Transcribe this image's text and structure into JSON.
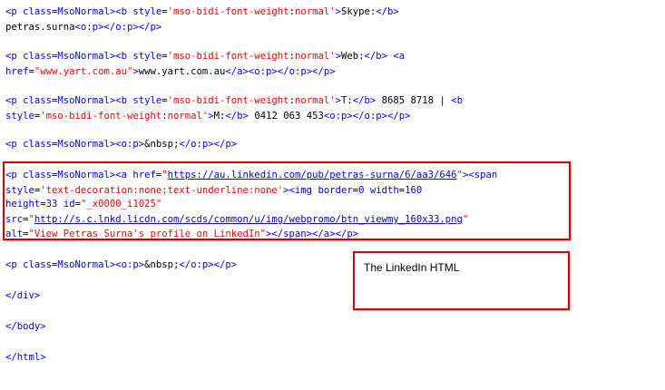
{
  "lines": [
    {
      "segs": [
        [
          "b",
          "<p "
        ],
        [
          "b",
          "class"
        ],
        [
          "t",
          "="
        ],
        [
          "b",
          "MsoNormal"
        ],
        [
          "b",
          "><b "
        ],
        [
          "b",
          "style"
        ],
        [
          "t",
          "="
        ],
        [
          "a",
          "'mso-bidi-font-weight"
        ],
        [
          "t",
          ":"
        ],
        [
          "a",
          "normal'"
        ],
        [
          "b",
          ">"
        ],
        [
          "t",
          "Skype:"
        ],
        [
          "b",
          "</b>"
        ]
      ]
    },
    {
      "segs": [
        [
          "t",
          "petras.surna"
        ],
        [
          "b",
          "<o:p></o:p></p>"
        ]
      ]
    },
    {
      "segs": []
    },
    {
      "segs": [
        [
          "b",
          "<p "
        ],
        [
          "b",
          "class"
        ],
        [
          "t",
          "="
        ],
        [
          "b",
          "MsoNormal"
        ],
        [
          "b",
          "><b "
        ],
        [
          "b",
          "style"
        ],
        [
          "t",
          "="
        ],
        [
          "a",
          "'mso-bidi-font-weight"
        ],
        [
          "t",
          ":"
        ],
        [
          "a",
          "normal'"
        ],
        [
          "b",
          ">"
        ],
        [
          "t",
          "Web:"
        ],
        [
          "b",
          "</b> <a"
        ]
      ]
    },
    {
      "segs": [
        [
          "b",
          "href"
        ],
        [
          "t",
          "="
        ],
        [
          "a",
          "\"www.yart.com.au\""
        ],
        [
          "b",
          ">"
        ],
        [
          "t",
          "www.yart.com.au"
        ],
        [
          "b",
          "</a><o:p></o:p></p>"
        ]
      ]
    },
    {
      "segs": []
    },
    {
      "segs": [
        [
          "b",
          "<p "
        ],
        [
          "b",
          "class"
        ],
        [
          "t",
          "="
        ],
        [
          "b",
          "MsoNormal"
        ],
        [
          "b",
          "><b "
        ],
        [
          "b",
          "style"
        ],
        [
          "t",
          "="
        ],
        [
          "a",
          "'mso-bidi-font-weight"
        ],
        [
          "t",
          ":"
        ],
        [
          "a",
          "normal'"
        ],
        [
          "b",
          ">"
        ],
        [
          "t",
          "T:"
        ],
        [
          "b",
          "</b>"
        ],
        [
          "t",
          " 8685 8718 | "
        ],
        [
          "b",
          "<b"
        ]
      ]
    },
    {
      "segs": [
        [
          "b",
          "style"
        ],
        [
          "t",
          "="
        ],
        [
          "a",
          "'mso-bidi-font-weight"
        ],
        [
          "t",
          ":"
        ],
        [
          "a",
          "normal'"
        ],
        [
          "b",
          ">"
        ],
        [
          "t",
          "M:"
        ],
        [
          "b",
          "</b>"
        ],
        [
          "t",
          " 0412 063 453"
        ],
        [
          "b",
          "<o:p></o:p></p>"
        ]
      ]
    },
    {
      "segs": []
    },
    {
      "segs": [
        [
          "b",
          "<p "
        ],
        [
          "b",
          "class"
        ],
        [
          "t",
          "="
        ],
        [
          "b",
          "MsoNormal"
        ],
        [
          "b",
          "><o:p>"
        ],
        [
          "t",
          "&nbsp;"
        ],
        [
          "b",
          "</o:p></p>"
        ]
      ]
    },
    {
      "segs": []
    },
    {
      "segs": [
        [
          "b",
          "<p "
        ],
        [
          "b",
          "class"
        ],
        [
          "t",
          "="
        ],
        [
          "b",
          "MsoNormal"
        ],
        [
          "b",
          "><a "
        ],
        [
          "b",
          "href"
        ],
        [
          "t",
          "="
        ],
        [
          "a",
          "\""
        ],
        [
          "link",
          "https://au.linkedin.com/pub/petras-surna/6/aa3/646"
        ],
        [
          "a",
          "\""
        ],
        [
          "b",
          "><span"
        ]
      ]
    },
    {
      "segs": [
        [
          "b",
          "style"
        ],
        [
          "t",
          "="
        ],
        [
          "a",
          "'text-decoration:none;text-underline:none'"
        ],
        [
          "b",
          "><img "
        ],
        [
          "b",
          "border"
        ],
        [
          "t",
          "="
        ],
        [
          "b",
          "0 "
        ],
        [
          "b",
          "width"
        ],
        [
          "t",
          "="
        ],
        [
          "b",
          "160"
        ]
      ]
    },
    {
      "segs": [
        [
          "b",
          "height"
        ],
        [
          "t",
          "="
        ],
        [
          "b",
          "33 "
        ],
        [
          "b",
          "id"
        ],
        [
          "t",
          "="
        ],
        [
          "a",
          "\"_x0000_i1025\""
        ]
      ]
    },
    {
      "segs": [
        [
          "b",
          "src"
        ],
        [
          "t",
          "="
        ],
        [
          "a",
          "\""
        ],
        [
          "link",
          "http://s.c.lnkd.licdn.com/scds/common/u/img/webpromo/btn_viewmy_160x33.png"
        ],
        [
          "a",
          "\""
        ]
      ]
    },
    {
      "segs": [
        [
          "b",
          "alt"
        ],
        [
          "t",
          "="
        ],
        [
          "a",
          "\"View Petras Surna's profile on LinkedIn\""
        ],
        [
          "b",
          "></span></a></p>"
        ]
      ]
    },
    {
      "segs": []
    },
    {
      "segs": [
        [
          "b",
          "<p "
        ],
        [
          "b",
          "class"
        ],
        [
          "t",
          "="
        ],
        [
          "b",
          "MsoNormal"
        ],
        [
          "b",
          "><o:p>"
        ],
        [
          "t",
          "&nbsp;"
        ],
        [
          "b",
          "</o:p></p>"
        ]
      ]
    },
    {
      "segs": []
    },
    {
      "segs": [
        [
          "b",
          "</div>"
        ]
      ]
    },
    {
      "segs": []
    },
    {
      "segs": [
        [
          "b",
          "</body>"
        ]
      ]
    },
    {
      "segs": []
    },
    {
      "segs": [
        [
          "b",
          "</html>"
        ]
      ]
    }
  ],
  "annotation": {
    "text": "The LinkedIn HTML"
  },
  "colors": {
    "tag": "#0000ff",
    "value": "#ff0000",
    "text": "#000000",
    "highlight_border": "#d40000"
  }
}
